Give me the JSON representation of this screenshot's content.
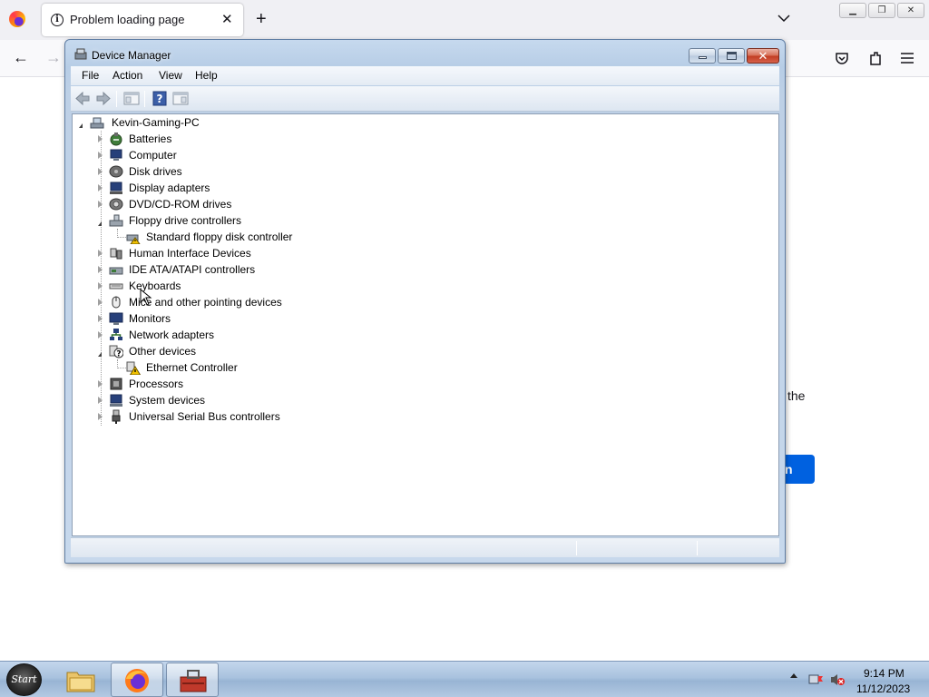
{
  "browser": {
    "tab_title": "Problem loading page",
    "tab_close": "✕",
    "new_tab": "+",
    "page_text_fragment": "the",
    "page_button_fragment": "n",
    "accent": "#0061e0"
  },
  "device_manager": {
    "title": "Device Manager",
    "menu": [
      "File",
      "Action",
      "View",
      "Help"
    ],
    "computer_name": "Kevin-Gaming-PC",
    "categories": [
      {
        "label": "Batteries",
        "icon": "battery-icon",
        "expanded": false
      },
      {
        "label": "Computer",
        "icon": "computer-icon",
        "expanded": false
      },
      {
        "label": "Disk drives",
        "icon": "disk-drive-icon",
        "expanded": false
      },
      {
        "label": "Display adapters",
        "icon": "display-adapter-icon",
        "expanded": false
      },
      {
        "label": "DVD/CD-ROM drives",
        "icon": "dvd-drive-icon",
        "expanded": false
      },
      {
        "label": "Floppy drive controllers",
        "icon": "floppy-controller-icon",
        "expanded": true,
        "children": [
          {
            "label": "Standard floppy disk controller",
            "icon": "floppy-controller-warning-icon"
          }
        ]
      },
      {
        "label": "Human Interface Devices",
        "icon": "hid-icon",
        "expanded": false
      },
      {
        "label": "IDE ATA/ATAPI controllers",
        "icon": "ide-controller-icon",
        "expanded": false
      },
      {
        "label": "Keyboards",
        "icon": "keyboard-icon",
        "expanded": false
      },
      {
        "label": "Mice and other pointing devices",
        "icon": "mouse-icon",
        "expanded": false
      },
      {
        "label": "Monitors",
        "icon": "monitor-icon",
        "expanded": false
      },
      {
        "label": "Network adapters",
        "icon": "network-adapter-icon",
        "expanded": false
      },
      {
        "label": "Other devices",
        "icon": "unknown-device-icon",
        "expanded": true,
        "children": [
          {
            "label": "Ethernet Controller",
            "icon": "warning-device-icon"
          }
        ]
      },
      {
        "label": "Processors",
        "icon": "processor-icon",
        "expanded": false
      },
      {
        "label": "System devices",
        "icon": "system-devices-icon",
        "expanded": false
      },
      {
        "label": "Universal Serial Bus controllers",
        "icon": "usb-icon",
        "expanded": false
      }
    ]
  },
  "taskbar": {
    "start_label": "Start",
    "apps": [
      "file-explorer-icon",
      "firefox-icon",
      "device-manager-icon"
    ],
    "time": "9:14 PM",
    "date": "11/12/2023"
  }
}
